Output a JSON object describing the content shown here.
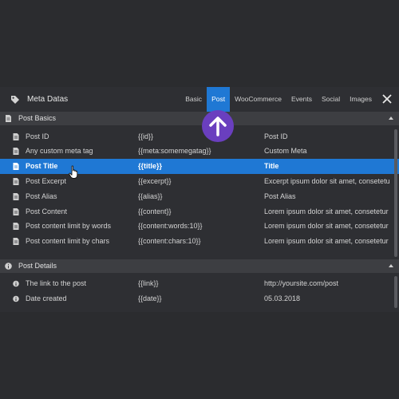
{
  "window": {
    "title": "Meta Datas"
  },
  "tabs": [
    {
      "label": "Basic",
      "active": false
    },
    {
      "label": "Post",
      "active": true
    },
    {
      "label": "WooCommerce",
      "active": false
    },
    {
      "label": "Events",
      "active": false
    },
    {
      "label": "Social",
      "active": false
    },
    {
      "label": "Images",
      "active": false
    }
  ],
  "sections": [
    {
      "label": "Post Basics",
      "icon": "document-icon",
      "rows": [
        {
          "name": "Post ID",
          "tag": "{{id}}",
          "value": "Post ID"
        },
        {
          "name": "Any custom meta tag",
          "tag": "{{meta:somemegatag}}",
          "value": "Custom Meta"
        },
        {
          "name": "Post Title",
          "tag": "{{title}}",
          "value": "Title",
          "selected": true
        },
        {
          "name": "Post Excerpt",
          "tag": "{{excerpt}}",
          "value": "Excerpt ipsum dolor sit amet, consetetur"
        },
        {
          "name": "Post Alias",
          "tag": "{{alias}}",
          "value": "Post Alias"
        },
        {
          "name": "Post Content",
          "tag": "{{content}}",
          "value": "Lorem ipsum dolor sit amet, consetetur s"
        },
        {
          "name": "Post content limit by words",
          "tag": "{{content:words:10}}",
          "value": "Lorem ipsum dolor sit amet, consetetur s"
        },
        {
          "name": "Post content limit by chars",
          "tag": "{{content:chars:10}}",
          "value": "Lorem ipsum dolor sit amet, consetetur s"
        }
      ]
    },
    {
      "label": "Post Details",
      "icon": "info-icon",
      "rows": [
        {
          "name": "The link to the post",
          "tag": "{{link}}",
          "value": "http://yoursite.com/post"
        },
        {
          "name": "Date created",
          "tag": "{{date}}",
          "value": "05.03.2018"
        }
      ]
    }
  ],
  "colors": {
    "accent": "#1f78d4",
    "hint": "#6a3fbf",
    "panel": "#2e2f33",
    "section": "#3d3e42"
  }
}
